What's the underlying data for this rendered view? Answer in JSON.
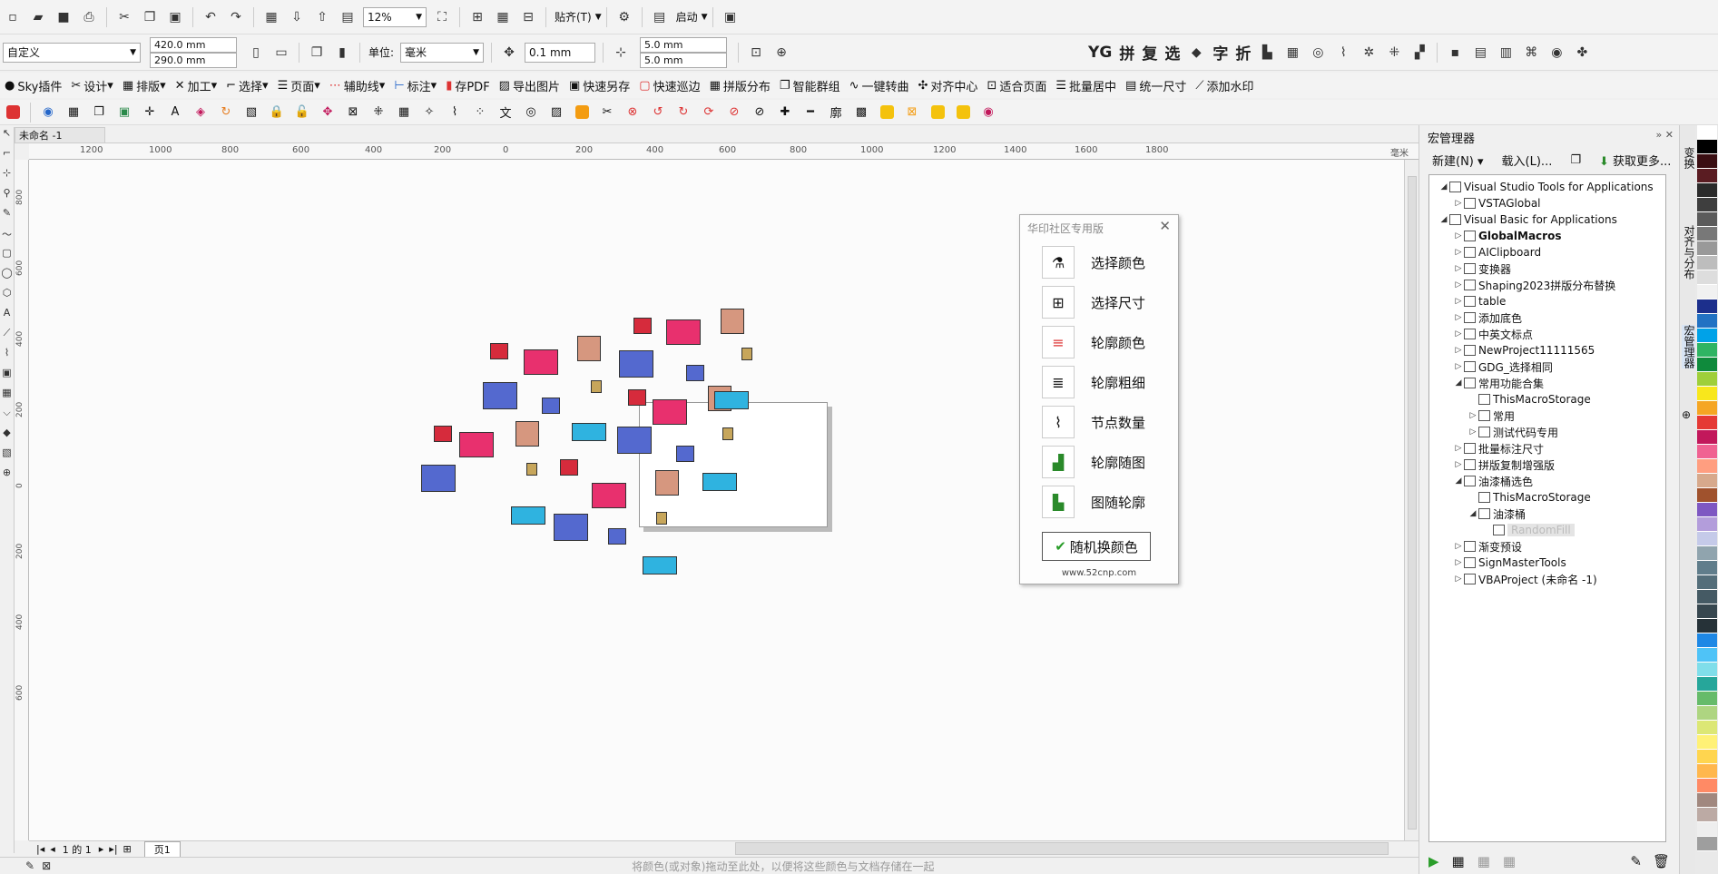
{
  "colors": {
    "red": "#d62b3c",
    "pink": "#e8306e",
    "salmon": "#d6977f",
    "blue": "#5469cf",
    "cyan": "#2fb3e0",
    "gold": "#c7a65b"
  },
  "toolbar1": {
    "zoom": "12%",
    "snap": "贴齐(T)",
    "launch": "启动"
  },
  "propbar": {
    "preset": "自定义",
    "width": "420.0 mm",
    "height": "290.0 mm",
    "unit_label": "单位:",
    "unit": "毫米",
    "nudge": "0.1 mm",
    "dup_x": "5.0 mm",
    "dup_y": "5.0 mm"
  },
  "pluginbar": [
    {
      "icon": "sky-icon",
      "label": "Sky插件"
    },
    {
      "icon": "scissors-icon",
      "label": "设计"
    },
    {
      "icon": "grid-icon",
      "label": "排版"
    },
    {
      "icon": "tools-icon",
      "label": "加工"
    },
    {
      "icon": "select-icon",
      "label": "选择"
    },
    {
      "icon": "page-icon",
      "label": "页面"
    },
    {
      "icon": "guide-icon",
      "label": "辅助线"
    },
    {
      "icon": "dimension-icon",
      "label": "标注"
    },
    {
      "icon": "pdf-icon",
      "label": "存PDF"
    },
    {
      "icon": "export-image-icon",
      "label": "导出图片"
    },
    {
      "icon": "save-as-icon",
      "label": "快速另存"
    },
    {
      "icon": "patrol-icon",
      "label": "快速巡边"
    },
    {
      "icon": "layout-icon",
      "label": "拼版分布"
    },
    {
      "icon": "group-icon",
      "label": "智能群组"
    },
    {
      "icon": "curve-icon",
      "label": "一键转曲"
    },
    {
      "icon": "align-center-icon",
      "label": "对齐中心"
    },
    {
      "icon": "fit-page-icon",
      "label": "适合页面"
    },
    {
      "icon": "batch-center-icon",
      "label": "批量居中"
    },
    {
      "icon": "same-size-icon",
      "label": "统一尺寸"
    },
    {
      "icon": "watermark-icon",
      "label": "添加水印"
    }
  ],
  "rightbar": [
    "拼",
    "复",
    "选",
    "字",
    "折"
  ],
  "document": {
    "tab": "未命名 -1",
    "page_tab": "页1",
    "page_counter": "1 的 1"
  },
  "ruler_h": [
    "1200",
    "1000",
    "800",
    "600",
    "400",
    "200",
    "0",
    "200",
    "400",
    "600",
    "800",
    "1000",
    "1200",
    "1400",
    "1600",
    "1800",
    "毫米"
  ],
  "ruler_v": [
    "800",
    "600",
    "400",
    "200",
    "0",
    "200",
    "400",
    "600"
  ],
  "dialog": {
    "title": "华印社区专用版",
    "buttons": [
      "选择颜色",
      "选择尺寸",
      "轮廓颜色",
      "轮廓粗细",
      "节点数量",
      "轮廓随图",
      "图随轮廓"
    ],
    "main_button": "随机换颜色",
    "footer": "www.52cnp.com"
  },
  "docker": {
    "title": "宏管理器",
    "new_label": "新建(N)",
    "load_label": "载入(L)...",
    "get_more": "获取更多...",
    "tree": [
      {
        "label": "Visual Studio Tools for Applications",
        "level": 0,
        "open": true
      },
      {
        "label": "VSTAGlobal",
        "level": 1,
        "open": false
      },
      {
        "label": "Visual Basic for Applications",
        "level": 0,
        "open": true
      },
      {
        "label": "GlobalMacros",
        "level": 1,
        "open": false,
        "bold": true
      },
      {
        "label": "AIClipboard",
        "level": 1,
        "open": false
      },
      {
        "label": "变换器",
        "level": 1,
        "open": false
      },
      {
        "label": "Shaping2023拼版分布替换",
        "level": 1,
        "open": false
      },
      {
        "label": "table",
        "level": 1,
        "open": false
      },
      {
        "label": "添加底色",
        "level": 1,
        "open": false
      },
      {
        "label": "中英文标点",
        "level": 1,
        "open": false
      },
      {
        "label": "NewProject11111565",
        "level": 1,
        "open": false
      },
      {
        "label": "GDG_选择相同",
        "level": 1,
        "open": false
      },
      {
        "label": "常用功能合集",
        "level": 1,
        "open": true
      },
      {
        "label": "ThisMacroStorage",
        "level": 2,
        "leaf": true
      },
      {
        "label": "常用",
        "level": 2,
        "open": false
      },
      {
        "label": "测试代码专用",
        "level": 2,
        "open": false
      },
      {
        "label": "批量标注尺寸",
        "level": 1,
        "open": false
      },
      {
        "label": "拼版复制增强版",
        "level": 1,
        "open": false
      },
      {
        "label": "油漆桶选色",
        "level": 1,
        "open": true
      },
      {
        "label": "ThisMacroStorage",
        "level": 2,
        "leaf": true
      },
      {
        "label": "油漆桶",
        "level": 2,
        "open": true
      },
      {
        "label": "RandomFill",
        "level": 3,
        "leaf": true,
        "selected": true
      },
      {
        "label": "渐变预设",
        "level": 1,
        "open": false
      },
      {
        "label": "SignMasterTools",
        "level": 1,
        "open": false
      },
      {
        "label": "VBAProject (未命名 -1)",
        "level": 1,
        "open": false
      }
    ]
  },
  "side_tabs": [
    "变换",
    "对齐与分布",
    "宏管理器"
  ],
  "status_hint": "将颜色(或对象)拖动至此处，以便将这些颜色与文档存储在一起",
  "palette": [
    "#ffffff",
    "#000000",
    "#3a0e12",
    "#5a1c22",
    "#2b2b2b",
    "#3e3e3e",
    "#5b5b5b",
    "#787878",
    "#999999",
    "#bdbdbd",
    "#dddddd",
    "#f1f1f1",
    "#1c2f8c",
    "#2272c3",
    "#00a2e8",
    "#2fb463",
    "#0f8a3c",
    "#9fcf3a",
    "#f8e71c",
    "#f5a623",
    "#e53935",
    "#c2185b",
    "#f06292",
    "#ff9e80",
    "#d7a98c",
    "#a0522d",
    "#7e57c2",
    "#b39ddb",
    "#c5cae9",
    "#90a4ae",
    "#607d8b",
    "#546e7a",
    "#455a64",
    "#37474f",
    "#263238",
    "#1e88e5",
    "#4fc3f7",
    "#80deea",
    "#26a69a",
    "#66bb6a",
    "#aed581",
    "#dce775",
    "#fff176",
    "#ffd54f",
    "#ffb74d",
    "#ff8a65",
    "#a1887f",
    "#bcaaa4",
    "#eeeeee",
    "#9e9e9e"
  ],
  "shapes": [
    {
      "c": "red"
    },
    {
      "c": "pink"
    },
    {
      "c": "salmon"
    },
    {
      "c": "red"
    },
    {
      "c": "pink"
    },
    {
      "c": "salmon"
    },
    {
      "c": "gold"
    },
    {
      "c": "blue"
    },
    {
      "c": "blue"
    },
    {
      "c": "gold"
    },
    {
      "c": "blue"
    },
    {
      "c": "blue"
    },
    {
      "c": "red"
    },
    {
      "c": "pink"
    },
    {
      "c": "salmon"
    },
    {
      "c": "cyan"
    },
    {
      "c": "red"
    },
    {
      "c": "pink"
    },
    {
      "c": "salmon"
    },
    {
      "c": "cyan"
    },
    {
      "c": "blue"
    },
    {
      "c": "gold"
    },
    {
      "c": "blue"
    },
    {
      "c": "blue"
    },
    {
      "c": "gold"
    },
    {
      "c": "red"
    },
    {
      "c": "pink"
    },
    {
      "c": "salmon"
    },
    {
      "c": "cyan"
    },
    {
      "c": "cyan"
    },
    {
      "c": "blue"
    },
    {
      "c": "gold"
    },
    {
      "c": "blue"
    },
    {
      "c": "cyan"
    }
  ]
}
